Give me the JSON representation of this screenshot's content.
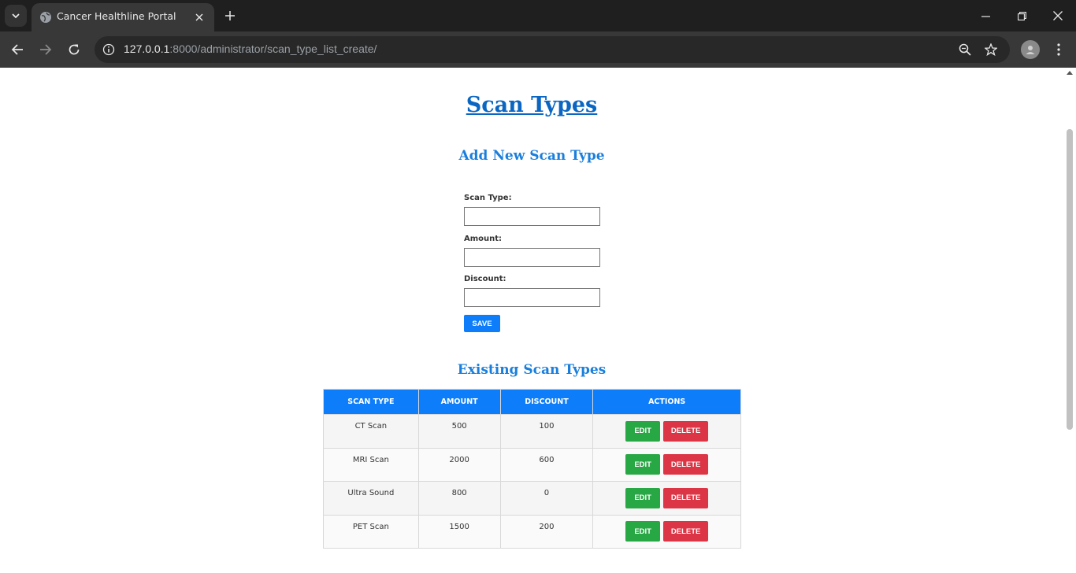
{
  "browser": {
    "tab_title": "Cancer Healthline Portal",
    "url_host": "127.0.0.1",
    "url_path": ":8000/administrator/scan_type_list_create/"
  },
  "page": {
    "title": "Scan Types",
    "form": {
      "heading": "Add New Scan Type",
      "scan_type_label": "Scan Type:",
      "scan_type_value": "",
      "amount_label": "Amount:",
      "amount_value": "",
      "discount_label": "Discount:",
      "discount_value": "",
      "save_label": "Save"
    },
    "list": {
      "heading": "Existing Scan Types",
      "columns": [
        "Scan Type",
        "Amount",
        "Discount",
        "Actions"
      ],
      "rows": [
        {
          "scan_type": "CT Scan",
          "amount": "500",
          "discount": "100"
        },
        {
          "scan_type": "MRI Scan",
          "amount": "2000",
          "discount": "600"
        },
        {
          "scan_type": "Ultra Sound",
          "amount": "800",
          "discount": "0"
        },
        {
          "scan_type": "PET Scan",
          "amount": "1500",
          "discount": "200"
        }
      ],
      "edit_label": "Edit",
      "delete_label": "Delete"
    }
  },
  "colors": {
    "primary": "#0d7dfa",
    "heading": "#1a7fdc",
    "edit": "#28a745",
    "delete": "#dc3545"
  }
}
